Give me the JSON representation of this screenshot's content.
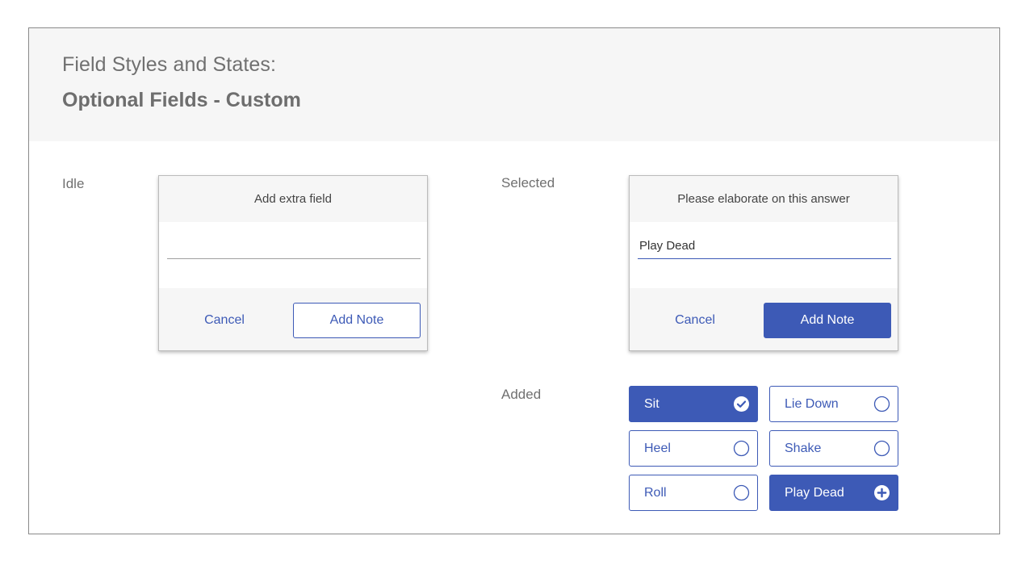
{
  "header": {
    "title": "Field Styles and States:",
    "subtitle": "Optional Fields - Custom"
  },
  "states": {
    "idle": "Idle",
    "selected": "Selected",
    "added": "Added"
  },
  "idle_card": {
    "title": "Add extra field",
    "input_value": "",
    "cancel_label": "Cancel",
    "add_label": "Add Note"
  },
  "selected_card": {
    "title": "Please elaborate on this answer",
    "input_value": "Play Dead",
    "cancel_label": "Cancel",
    "add_label": "Add Note"
  },
  "chips": [
    {
      "label": "Sit",
      "state": "selected",
      "icon": "check-circle-icon"
    },
    {
      "label": "Lie Down",
      "state": "unselected",
      "icon": "empty-circle-icon"
    },
    {
      "label": "Heel",
      "state": "unselected",
      "icon": "empty-circle-icon"
    },
    {
      "label": "Shake",
      "state": "unselected",
      "icon": "empty-circle-icon"
    },
    {
      "label": "Roll",
      "state": "unselected",
      "icon": "empty-circle-icon"
    },
    {
      "label": "Play Dead",
      "state": "selected",
      "icon": "plus-circle-icon"
    }
  ],
  "colors": {
    "accent": "#3d5ab6",
    "header_bg": "#f6f6f6",
    "text_gray": "#707070"
  }
}
